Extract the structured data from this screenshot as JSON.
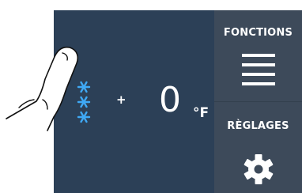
{
  "screen": {
    "temperature": {
      "sign": "+",
      "value": "0",
      "unit": "°F"
    },
    "mode_icon": "snowflake-icon"
  },
  "side_panel": {
    "functions_label": "FONCTIONS",
    "functions_icon": "menu-icon",
    "settings_label": "RÈGLAGES",
    "settings_icon": "gear-icon"
  },
  "colors": {
    "screen_bg": "#2c4057",
    "side_panel_bg": "#3d4a5a",
    "snowflake": "#3fa9f5",
    "text": "#ffffff"
  }
}
